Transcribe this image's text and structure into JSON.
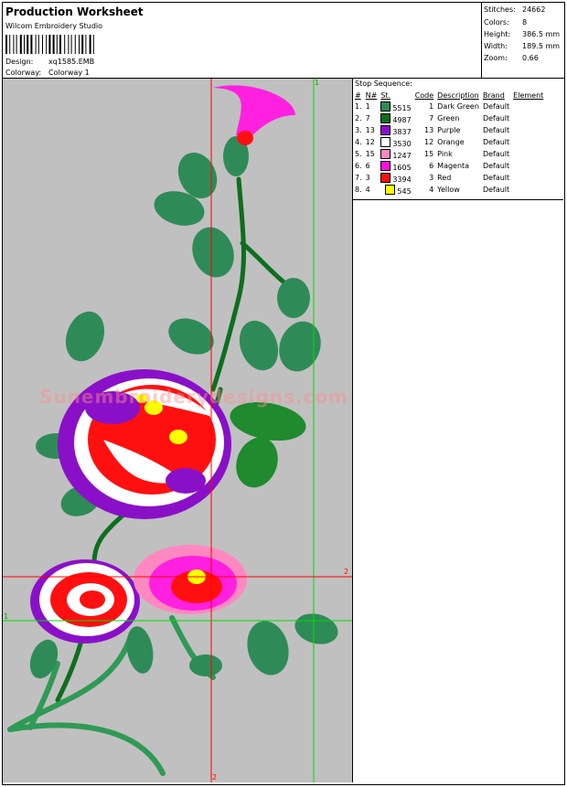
{
  "header": {
    "title": "Production Worksheet",
    "company": "Wilcom Embroidery Studio",
    "design_label": "Design:",
    "design_value": "xq1585.EMB",
    "colorway_label": "Colorway:",
    "colorway_value": "Colorway 1"
  },
  "stats": [
    {
      "label": "Stitches:",
      "value": "24662"
    },
    {
      "label": "Colors:",
      "value": "8"
    },
    {
      "label": "Height:",
      "value": "386.5 mm"
    },
    {
      "label": "Width:",
      "value": "189.5 mm"
    },
    {
      "label": "Zoom:",
      "value": "0.66"
    }
  ],
  "stop_sequence": {
    "title": "Stop Sequence:",
    "columns": [
      "#",
      "N#",
      "St.",
      "Code",
      "Description",
      "Brand",
      "Element"
    ],
    "rows": [
      {
        "num": "1.",
        "n": "1",
        "color": "#2e8b57",
        "st": "5515",
        "code": "1",
        "desc": "Dark Green",
        "brand": "Default"
      },
      {
        "num": "2.",
        "n": "7",
        "color": "#0e6e1e",
        "st": "4987",
        "code": "7",
        "desc": "Green",
        "brand": "Default"
      },
      {
        "num": "3.",
        "n": "13",
        "color": "#8a10c8",
        "st": "3837",
        "code": "13",
        "desc": "Purple",
        "brand": "Default"
      },
      {
        "num": "4.",
        "n": "12",
        "color": "#ffffff",
        "st": "3530",
        "code": "12",
        "desc": "Orange",
        "brand": "Default"
      },
      {
        "num": "5.",
        "n": "15",
        "color": "#ff88c0",
        "st": "1247",
        "code": "15",
        "desc": "Pink",
        "brand": "Default"
      },
      {
        "num": "6.",
        "n": "6",
        "color": "#ff10e0",
        "st": "1605",
        "code": "6",
        "desc": "Magenta",
        "brand": "Default"
      },
      {
        "num": "7.",
        "n": "3",
        "color": "#ff1010",
        "st": "3394",
        "code": "3",
        "desc": "Red",
        "brand": "Default"
      },
      {
        "num": "8.",
        "n": "4",
        "color": "#ffff00",
        "st": "545",
        "code": "4",
        "desc": "Yellow",
        "brand": "Default"
      }
    ]
  },
  "watermark": "Sunembroiderydesigns.com",
  "guides": {
    "v1": "1",
    "v2": "2",
    "h1": "1",
    "h2": "2"
  },
  "colors": {
    "canvas": "#c0c0c0",
    "guide_red": "#ff0000",
    "guide_green": "#00dd00"
  }
}
